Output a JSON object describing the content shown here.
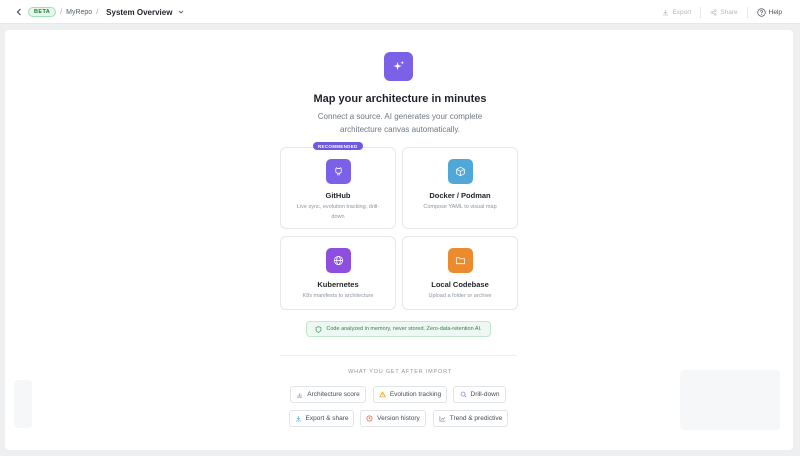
{
  "topbar": {
    "beta": "BETA",
    "repo": "MyRepo",
    "sep": "/",
    "title": "System Overview",
    "export": "Export",
    "share": "Share",
    "help": "Help"
  },
  "hero": {
    "icon": "sparkles-icon",
    "title": "Map your architecture in minutes",
    "subtitle": "Connect a source. AI generates your complete architecture canvas automatically."
  },
  "sources": {
    "recommended": "RECOMMENDED",
    "items": [
      {
        "name": "GitHub",
        "desc": "Live sync, evolution tracking, drill-down",
        "icon": "github-icon",
        "color": "#7b61e8"
      },
      {
        "name": "Docker / Podman",
        "desc": "Compose YAML to visual map",
        "icon": "cube-icon",
        "color": "#4fa8d8"
      },
      {
        "name": "Kubernetes",
        "desc": "K8s manifests to architecture",
        "icon": "globe-icon",
        "color": "#8e4fe0"
      },
      {
        "name": "Local Codebase",
        "desc": "Upload a folder or archive",
        "icon": "folder-icon",
        "color": "#ec8a2e"
      }
    ]
  },
  "notice": "Code analyzed in memory, never stored. Zero-data-retention AI.",
  "after": {
    "label": "WHAT YOU GET AFTER IMPORT",
    "features": [
      "Architecture score",
      "Evolution tracking",
      "Drill-down",
      "Export & share",
      "Version history",
      "Trend & predictive"
    ]
  },
  "colors": {
    "accent": "#7b61e8",
    "notice_bg": "#ecf8f1",
    "warning": "#e3a008",
    "error": "#e0593f"
  }
}
